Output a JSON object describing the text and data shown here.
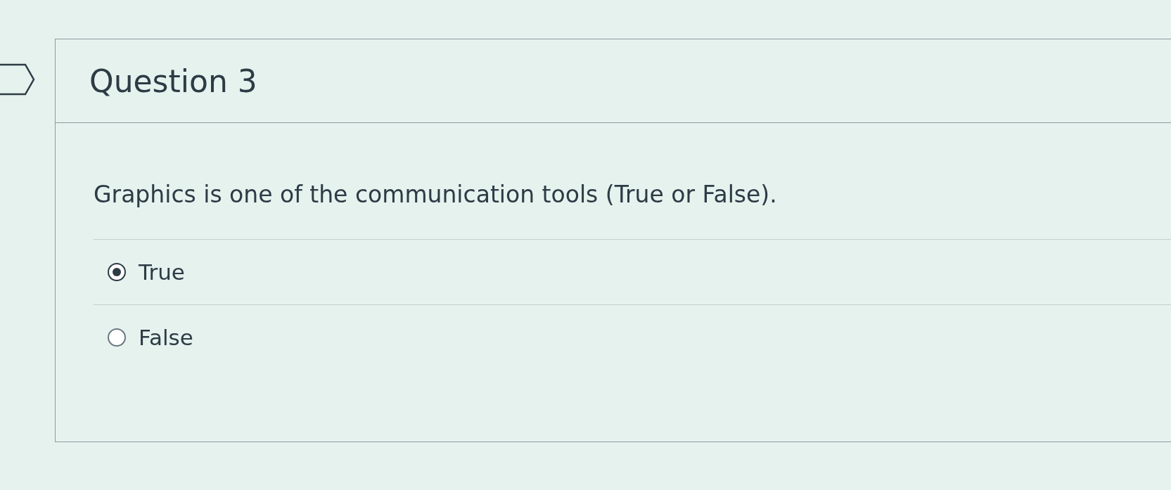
{
  "question": {
    "title": "Question 3",
    "text": "Graphics is one of the communication tools (True or False).",
    "options": [
      {
        "label": "True",
        "selected": true
      },
      {
        "label": "False",
        "selected": false
      }
    ]
  }
}
